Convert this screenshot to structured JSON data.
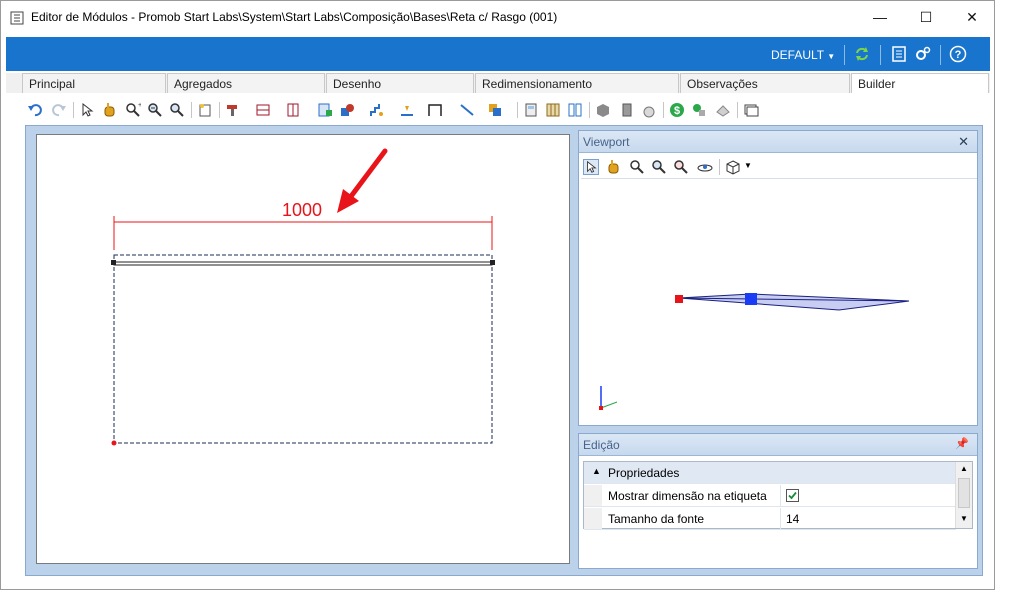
{
  "window": {
    "title": "Editor de Módulos - Promob Start Labs\\System\\Start Labs\\Composição\\Bases\\Reta c/ Rasgo (001)",
    "minimize_glyph": "—",
    "maximize_glyph": "☐",
    "close_glyph": "✕"
  },
  "ribbon": {
    "profile_label": "DEFAULT",
    "accent_color": "#1874cd"
  },
  "tabs": [
    {
      "label": "Principal"
    },
    {
      "label": "Agregados"
    },
    {
      "label": "Desenho"
    },
    {
      "label": "Redimensionamento"
    },
    {
      "label": "Observações"
    },
    {
      "label": "Builder"
    }
  ],
  "toolbar_icons": [
    "undo-icon",
    "redo-icon",
    "select-icon",
    "pan-icon",
    "zoom-window-icon",
    "zoom-in-icon",
    "zoom-out-icon",
    "new-icon",
    "paint-icon",
    "shelf-icon",
    "door-icon",
    "insert-icon",
    "rotate-icon",
    "stairs-icon",
    "measure-icon",
    "frame-icon",
    "line-icon",
    "color-icon",
    "calculator-icon",
    "grid-icon",
    "split-icon",
    "cube-icon",
    "box-icon",
    "money-bag-icon",
    "dollar-icon",
    "exchange-icon",
    "eraser-icon",
    "monitor-icon"
  ],
  "canvas": {
    "dimension_value": "1000",
    "dimension_color": "#e8141a"
  },
  "viewport": {
    "title": "Viewport",
    "close_glyph": "✕"
  },
  "edicao": {
    "title": "Edição",
    "group_label": "Propriedades",
    "properties": [
      {
        "name": "Mostrar dimensão na etiqueta",
        "value": "",
        "checked": true
      },
      {
        "name": "Tamanho da fonte",
        "value": "14"
      }
    ]
  }
}
